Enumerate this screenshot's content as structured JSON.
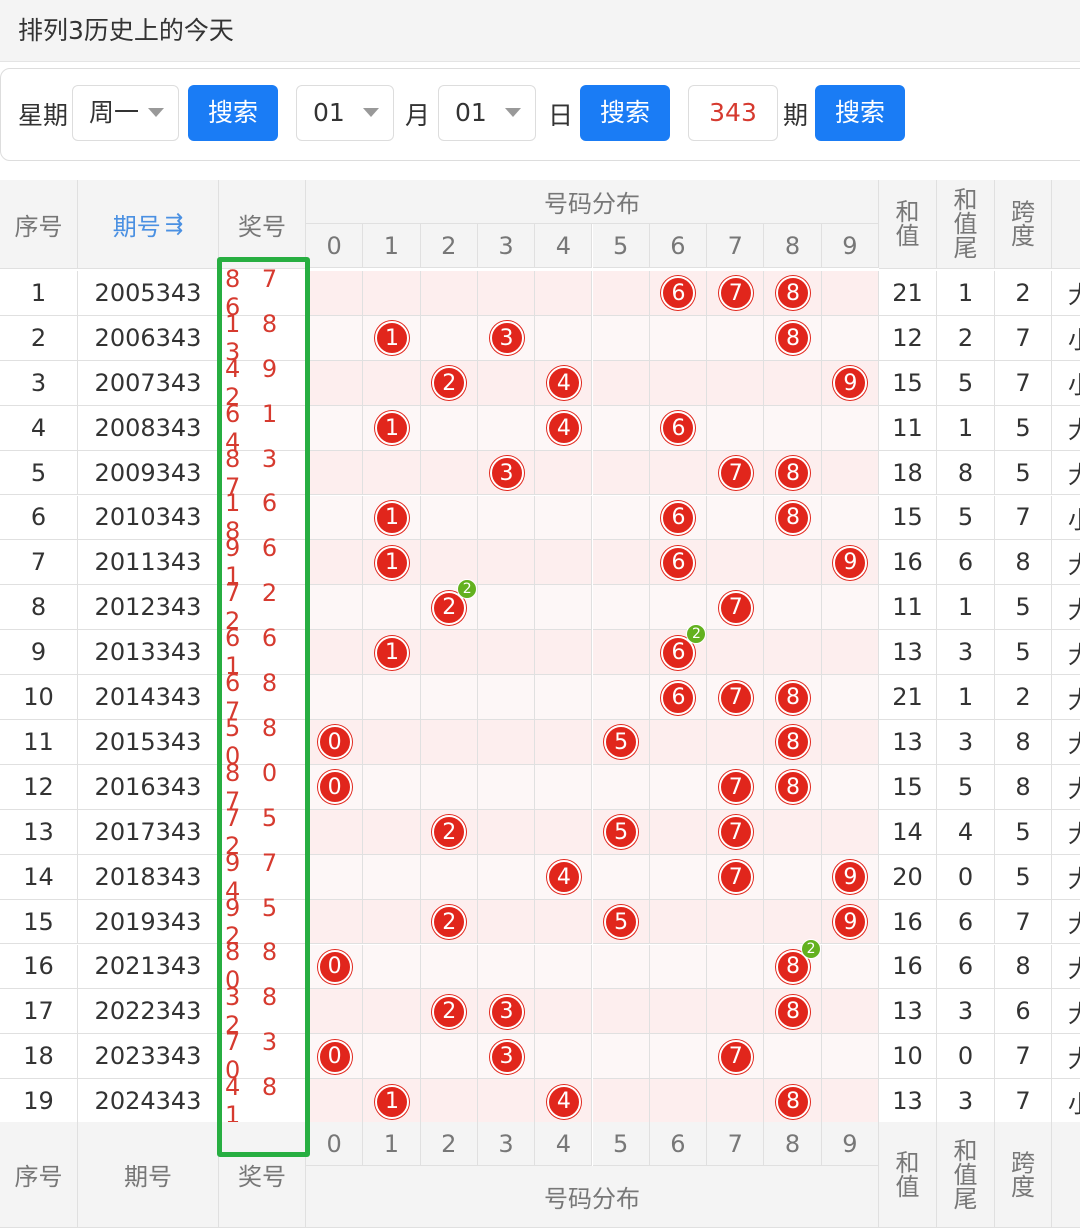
{
  "app": {
    "title": "排列3历史上的今天"
  },
  "search": {
    "weekday_label": "星期",
    "weekday_value": "周一",
    "search_label": "搜索",
    "month_value": "01",
    "month_label": "月",
    "day_value": "01",
    "day_label": "日",
    "period_value": "343",
    "period_label": "期"
  },
  "table": {
    "headers": {
      "index": "序号",
      "issue": "期号",
      "issue_sort_icon": "sort-icon",
      "draw": "奖号",
      "distribution": "号码分布",
      "sum": "和值",
      "sum_tail": "和值尾",
      "span": "跨度"
    },
    "digits": [
      "0",
      "1",
      "2",
      "3",
      "4",
      "5",
      "6",
      "7",
      "8",
      "9"
    ],
    "rows": [
      {
        "index": "1",
        "issue": "2005343",
        "draw": "8 7 6",
        "sum": "21",
        "tail": "1",
        "span": "2",
        "size": "大",
        "balls": [
          6,
          7,
          8
        ],
        "repeat": null
      },
      {
        "index": "2",
        "issue": "2006343",
        "draw": "1 8 3",
        "sum": "12",
        "tail": "2",
        "span": "7",
        "size": "小",
        "balls": [
          1,
          3,
          8
        ],
        "repeat": null
      },
      {
        "index": "3",
        "issue": "2007343",
        "draw": "4 9 2",
        "sum": "15",
        "tail": "5",
        "span": "7",
        "size": "小",
        "balls": [
          2,
          4,
          9
        ],
        "repeat": null
      },
      {
        "index": "4",
        "issue": "2008343",
        "draw": "6 1 4",
        "sum": "11",
        "tail": "1",
        "span": "5",
        "size": "大",
        "balls": [
          1,
          4,
          6
        ],
        "repeat": null
      },
      {
        "index": "5",
        "issue": "2009343",
        "draw": "8 3 7",
        "sum": "18",
        "tail": "8",
        "span": "5",
        "size": "大",
        "balls": [
          3,
          7,
          8
        ],
        "repeat": null
      },
      {
        "index": "6",
        "issue": "2010343",
        "draw": "1 6 8",
        "sum": "15",
        "tail": "5",
        "span": "7",
        "size": "小",
        "balls": [
          1,
          6,
          8
        ],
        "repeat": null
      },
      {
        "index": "7",
        "issue": "2011343",
        "draw": "9 6 1",
        "sum": "16",
        "tail": "6",
        "span": "8",
        "size": "大",
        "balls": [
          1,
          6,
          9
        ],
        "repeat": null
      },
      {
        "index": "8",
        "issue": "2012343",
        "draw": "7 2 2",
        "sum": "11",
        "tail": "1",
        "span": "5",
        "size": "大",
        "balls": [
          2,
          7
        ],
        "repeat": {
          "digit": 2,
          "count": "2"
        }
      },
      {
        "index": "9",
        "issue": "2013343",
        "draw": "6 6 1",
        "sum": "13",
        "tail": "3",
        "span": "5",
        "size": "大",
        "balls": [
          1,
          6
        ],
        "repeat": {
          "digit": 6,
          "count": "2"
        }
      },
      {
        "index": "10",
        "issue": "2014343",
        "draw": "6 8 7",
        "sum": "21",
        "tail": "1",
        "span": "2",
        "size": "大",
        "balls": [
          6,
          7,
          8
        ],
        "repeat": null
      },
      {
        "index": "11",
        "issue": "2015343",
        "draw": "5 8 0",
        "sum": "13",
        "tail": "3",
        "span": "8",
        "size": "大",
        "balls": [
          0,
          5,
          8
        ],
        "repeat": null
      },
      {
        "index": "12",
        "issue": "2016343",
        "draw": "8 0 7",
        "sum": "15",
        "tail": "5",
        "span": "8",
        "size": "大",
        "balls": [
          0,
          7,
          8
        ],
        "repeat": null
      },
      {
        "index": "13",
        "issue": "2017343",
        "draw": "7 5 2",
        "sum": "14",
        "tail": "4",
        "span": "5",
        "size": "大",
        "balls": [
          2,
          5,
          7
        ],
        "repeat": null
      },
      {
        "index": "14",
        "issue": "2018343",
        "draw": "9 7 4",
        "sum": "20",
        "tail": "0",
        "span": "5",
        "size": "大",
        "balls": [
          4,
          7,
          9
        ],
        "repeat": null
      },
      {
        "index": "15",
        "issue": "2019343",
        "draw": "9 5 2",
        "sum": "16",
        "tail": "6",
        "span": "7",
        "size": "大",
        "balls": [
          2,
          5,
          9
        ],
        "repeat": null
      },
      {
        "index": "16",
        "issue": "2021343",
        "draw": "8 8 0",
        "sum": "16",
        "tail": "6",
        "span": "8",
        "size": "大",
        "balls": [
          0,
          8
        ],
        "repeat": {
          "digit": 8,
          "count": "2"
        }
      },
      {
        "index": "17",
        "issue": "2022343",
        "draw": "3 8 2",
        "sum": "13",
        "tail": "3",
        "span": "6",
        "size": "大",
        "balls": [
          2,
          3,
          8
        ],
        "repeat": null
      },
      {
        "index": "18",
        "issue": "2023343",
        "draw": "7 3 0",
        "sum": "10",
        "tail": "0",
        "span": "7",
        "size": "大",
        "balls": [
          0,
          3,
          7
        ],
        "repeat": null
      },
      {
        "index": "19",
        "issue": "2024343",
        "draw": "4 8 1",
        "sum": "13",
        "tail": "3",
        "span": "7",
        "size": "小",
        "balls": [
          1,
          4,
          8
        ],
        "repeat": null
      }
    ]
  },
  "colors": {
    "accent": "#1a7cf5",
    "ball": "#e1261c",
    "repeat_badge": "#63b11f",
    "highlight_box": "#27ae41",
    "draw_text": "#d63a2f"
  }
}
